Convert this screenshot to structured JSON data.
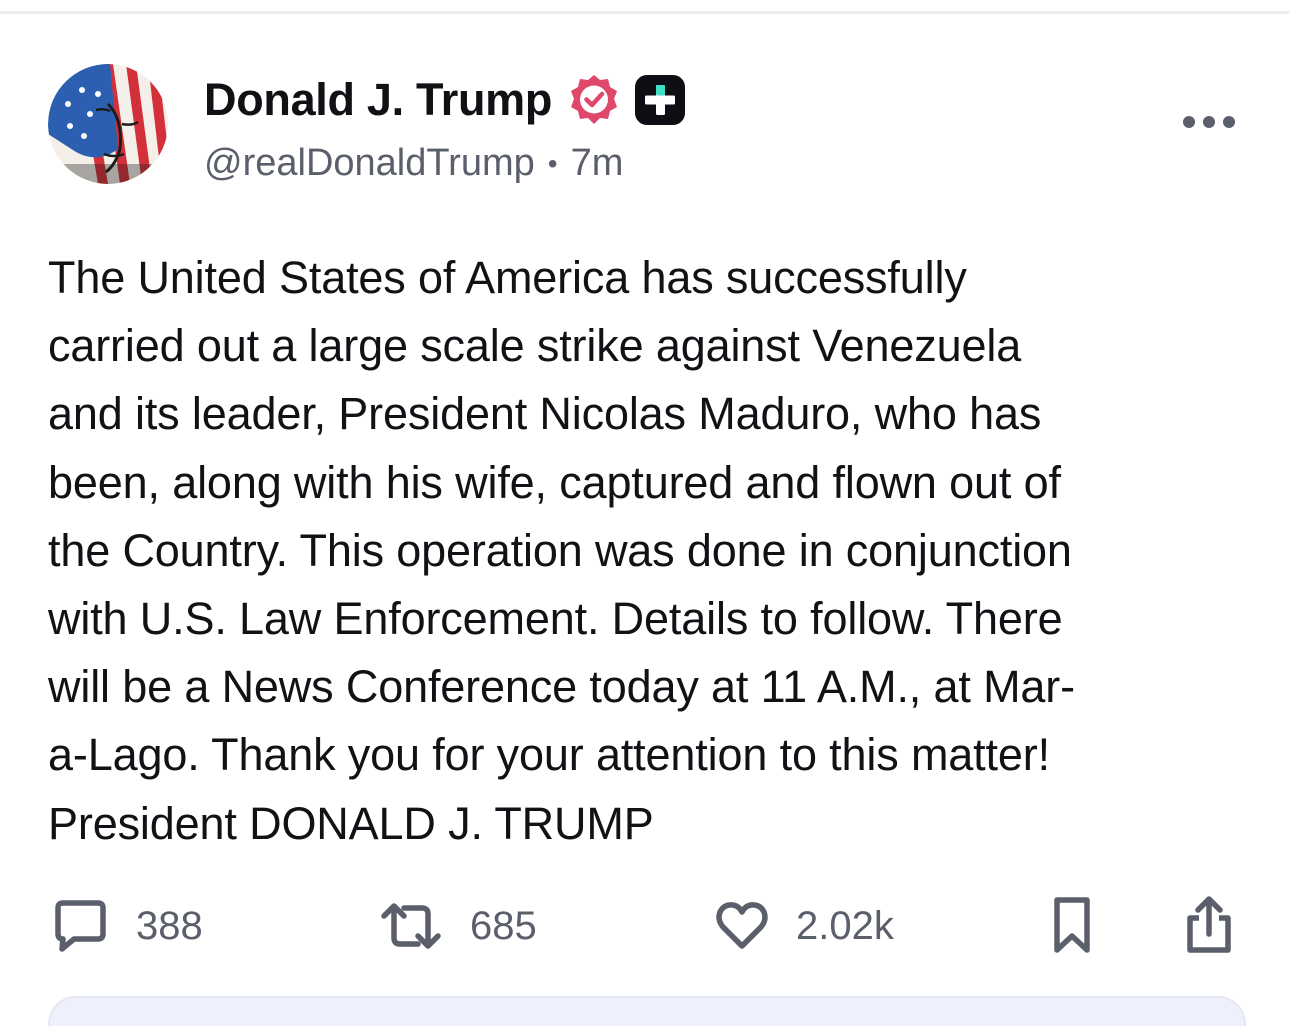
{
  "post": {
    "author": {
      "display_name": "Donald J. Trump",
      "handle": "@realDonaldTrump",
      "verified": true,
      "verified_icon": "verified-check-icon",
      "plus_icon": "truth-plus-icon"
    },
    "timestamp": "7m",
    "separator": "•",
    "text_lines": [
      "The United States of America has successfully",
      "carried out a large scale strike against Venezuela",
      "and its leader, President Nicolas Maduro, who has",
      "been, along with his wife, captured and flown out of",
      "the Country. This operation was done in conjunction",
      "with U.S. Law Enforcement. Details to follow. There",
      "will be a News Conference today at 11 A.M., at Mar-",
      "a-Lago. Thank you for your attention to this matter!",
      "President DONALD J. TRUMP"
    ],
    "stats": {
      "replies": "388",
      "retruths": "685",
      "likes": "2.02k"
    }
  },
  "colors": {
    "verified_badge": "#e0486b",
    "plus_badge": "#0d0f14",
    "plus_accent": "#3ee0c5",
    "text_primary": "#101216",
    "text_secondary": "#5a5f6b",
    "icon_gray": "#5a5f6b",
    "next_card_bg": "#eef0fb"
  },
  "icons": {
    "more": "more-horizontal-icon",
    "reply": "reply-bubble-icon",
    "retruth": "retruth-arrows-icon",
    "like": "heart-icon",
    "bookmark": "bookmark-icon",
    "share": "share-icon"
  }
}
